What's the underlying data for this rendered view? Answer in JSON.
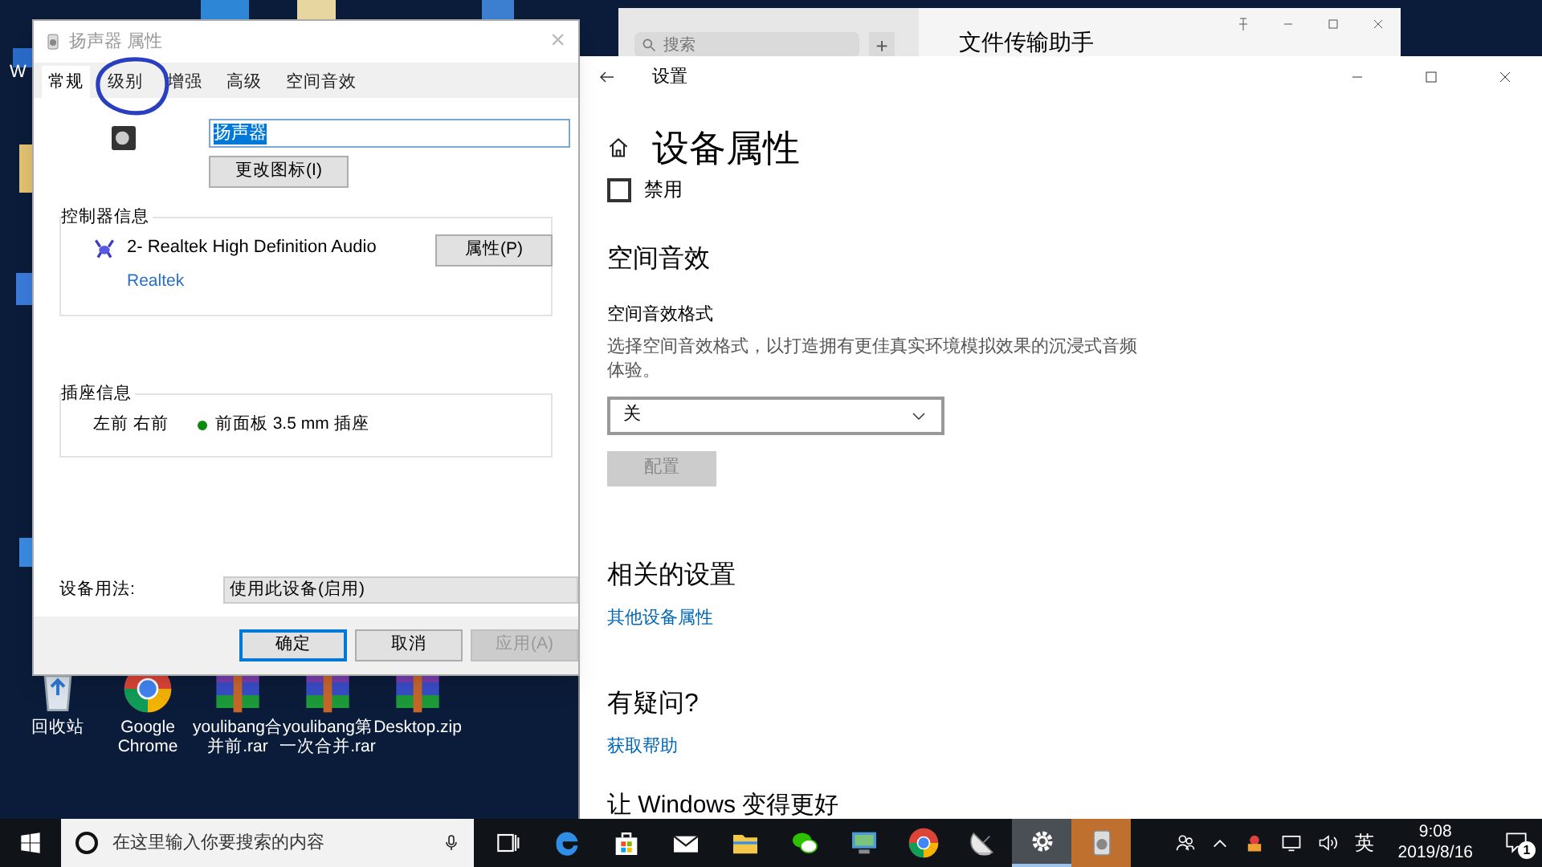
{
  "desktop": {
    "edge_labels": [
      "W"
    ],
    "icons": [
      {
        "kind": "recycle",
        "label": "回收站"
      },
      {
        "kind": "chrome",
        "label": "Google\nChrome"
      },
      {
        "kind": "rar",
        "label": "youlibang合并前.rar"
      },
      {
        "kind": "rar",
        "label": "youlibang第一次合并.rar"
      },
      {
        "kind": "rar",
        "label": "Desktop.zip"
      }
    ]
  },
  "chat_window": {
    "search": {
      "placeholder": "搜索"
    },
    "add": "+",
    "title": "文件传输助手"
  },
  "sound_dialog": {
    "title": "扬声器 属性",
    "close": "×",
    "tabs": [
      {
        "label": "常规",
        "selected": true
      },
      {
        "label": "级别",
        "selected": false,
        "annotated": true
      },
      {
        "label": "增强",
        "selected": false
      },
      {
        "label": "高级",
        "selected": false
      },
      {
        "label": "空间音效",
        "selected": false
      }
    ],
    "name_field": {
      "value": "扬声器",
      "text_selected": true
    },
    "change_icon": "更改图标(I)",
    "controller": {
      "heading": "控制器信息",
      "device": "2- Realtek High Definition Audio",
      "properties": "属性(P)",
      "vendor": "Realtek"
    },
    "jack": {
      "heading": "插座信息",
      "channels": "左前 右前",
      "color": "#0a8a0a",
      "description": "前面板 3.5 mm 插座"
    },
    "usage": {
      "label": "设备用法:",
      "value": "使用此设备(启用)"
    },
    "buttons": [
      {
        "label": "确定",
        "focused": true,
        "disabled": false
      },
      {
        "label": "取消",
        "focused": false,
        "disabled": false
      },
      {
        "label": "应用(A)",
        "focused": false,
        "disabled": true
      }
    ]
  },
  "settings_window": {
    "title": "设置",
    "heading": "设备属性",
    "disable": {
      "label": "禁用",
      "checked": false
    },
    "spatial": {
      "heading": "空间音效",
      "format_label": "空间音效格式",
      "description": "选择空间音效格式，以打造拥有更佳真实环境模拟效果的沉浸式音频体验。",
      "value": "关",
      "configure": {
        "label": "配置",
        "disabled": true
      }
    },
    "related": {
      "heading": "相关的设置",
      "link": "其他设备属性"
    },
    "help": {
      "heading": "有疑问?",
      "link": "获取帮助"
    },
    "feedback": {
      "heading": "让 Windows 变得更好"
    }
  },
  "taskbar": {
    "search": {
      "placeholder": "在这里输入你要搜索的内容"
    },
    "apps": [
      {
        "kind": "taskview",
        "active": false,
        "flashing": false
      },
      {
        "kind": "edge",
        "active": false,
        "flashing": false
      },
      {
        "kind": "store",
        "active": false,
        "flashing": false
      },
      {
        "kind": "mail",
        "active": false,
        "flashing": false
      },
      {
        "kind": "explorer",
        "active": false,
        "flashing": false
      },
      {
        "kind": "wechat",
        "active": false,
        "flashing": false
      },
      {
        "kind": "monitor",
        "active": false,
        "flashing": false
      },
      {
        "kind": "chrome",
        "active": false,
        "flashing": false
      },
      {
        "kind": "satellite",
        "active": false,
        "flashing": false
      },
      {
        "kind": "settings",
        "active": true,
        "flashing": false
      },
      {
        "kind": "speaker",
        "active": false,
        "flashing": true
      }
    ],
    "ime": "英",
    "time": "9:08",
    "date": "2019/8/16",
    "notifications": "1"
  }
}
